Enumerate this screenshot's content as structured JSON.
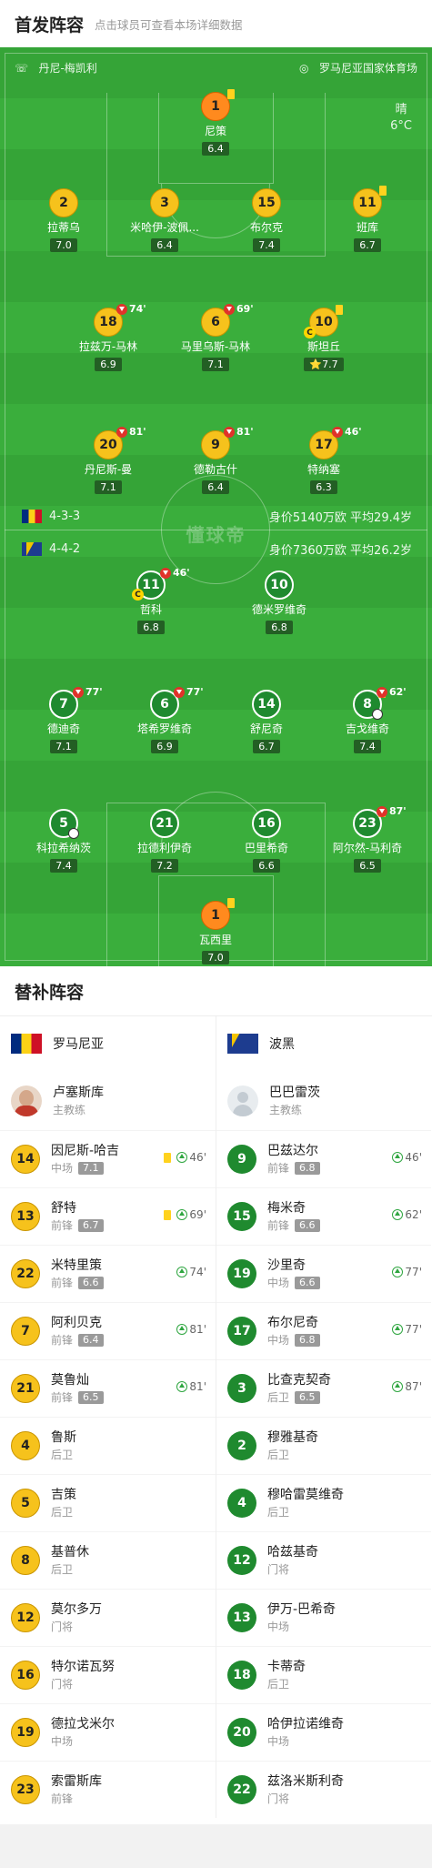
{
  "header": {
    "title": "首发阵容",
    "subtitle": "点击球员可查看本场详细数据"
  },
  "pitch_info": {
    "referee": "丹尼-梅凯利",
    "stadium": "罗马尼亚国家体育场",
    "weather": "晴",
    "temperature": "6°C",
    "watermark": "懂球帝"
  },
  "home": {
    "name": "罗马尼亚",
    "formation": "4-3-3",
    "value_label": "身价5140万欧 平均29.4岁",
    "players": [
      {
        "num": "1",
        "name": "尼策",
        "rating": "6.4",
        "style": "o",
        "yellow": true
      },
      {
        "num": "2",
        "name": "拉蒂乌",
        "rating": "7.0",
        "style": "y"
      },
      {
        "num": "3",
        "name": "米哈伊-波佩...",
        "rating": "6.4",
        "style": "y"
      },
      {
        "num": "15",
        "name": "布尔克",
        "rating": "7.4",
        "style": "y"
      },
      {
        "num": "11",
        "name": "班库",
        "rating": "6.7",
        "style": "y",
        "yellow": true
      },
      {
        "num": "18",
        "name": "拉兹万-马林",
        "rating": "6.9",
        "style": "y",
        "off": "74'"
      },
      {
        "num": "6",
        "name": "马里乌斯-马林",
        "rating": "7.1",
        "style": "y",
        "off": "69'"
      },
      {
        "num": "10",
        "name": "斯坦丘",
        "rating": "7.7",
        "style": "y",
        "yellow": true,
        "captain": "C",
        "star": "⭐"
      },
      {
        "num": "20",
        "name": "丹尼斯-曼",
        "rating": "7.1",
        "style": "y",
        "off": "81'"
      },
      {
        "num": "9",
        "name": "德勒古什",
        "rating": "6.4",
        "style": "y",
        "off": "81'"
      },
      {
        "num": "17",
        "name": "特纳塞",
        "rating": "6.3",
        "style": "y",
        "off": "46'"
      }
    ]
  },
  "away": {
    "name": "波黑",
    "formation": "4-4-2",
    "value_label": "身价7360万欧 平均26.2岁",
    "players": [
      {
        "num": "11",
        "name": "哲科",
        "rating": "6.8",
        "style": "g",
        "off": "46'",
        "captain": "C"
      },
      {
        "num": "10",
        "name": "德米罗维奇",
        "rating": "6.8",
        "style": "g"
      },
      {
        "num": "7",
        "name": "德迪奇",
        "rating": "7.1",
        "style": "g",
        "off": "77'"
      },
      {
        "num": "6",
        "name": "塔希罗维奇",
        "rating": "6.9",
        "style": "g",
        "off": "77'"
      },
      {
        "num": "14",
        "name": "舒尼奇",
        "rating": "6.7",
        "style": "g"
      },
      {
        "num": "8",
        "name": "吉戈维奇",
        "rating": "7.4",
        "style": "g",
        "off": "62'",
        "yellow": true,
        "goal": true
      },
      {
        "num": "5",
        "name": "科拉希纳茨",
        "rating": "7.4",
        "style": "g",
        "goal": true
      },
      {
        "num": "21",
        "name": "拉德利伊奇",
        "rating": "7.2",
        "style": "g"
      },
      {
        "num": "16",
        "name": "巴里希奇",
        "rating": "6.6",
        "style": "g"
      },
      {
        "num": "23",
        "name": "阿尔然-马利奇",
        "rating": "6.5",
        "style": "g",
        "off": "87'",
        "yellow": true
      },
      {
        "num": "1",
        "name": "瓦西里",
        "rating": "7.0",
        "style": "o",
        "yellow": true
      }
    ]
  },
  "bench": {
    "title": "替补阵容",
    "home": {
      "team": "罗马尼亚",
      "coach": {
        "name": "卢塞斯库",
        "role": "主教练"
      },
      "subs": [
        {
          "num": "14",
          "name": "因尼斯-哈吉",
          "pos": "中场",
          "rating": "7.1",
          "yellow": true,
          "in": "46'"
        },
        {
          "num": "13",
          "name": "舒特",
          "pos": "前锋",
          "rating": "6.7",
          "yellow": true,
          "in": "69'"
        },
        {
          "num": "22",
          "name": "米特里策",
          "pos": "前锋",
          "rating": "6.6",
          "in": "74'"
        },
        {
          "num": "7",
          "name": "阿利贝克",
          "pos": "前锋",
          "rating": "6.4",
          "in": "81'"
        },
        {
          "num": "21",
          "name": "莫鲁灿",
          "pos": "前锋",
          "rating": "6.5",
          "in": "81'"
        },
        {
          "num": "4",
          "name": "鲁斯",
          "pos": "后卫"
        },
        {
          "num": "5",
          "name": "吉策",
          "pos": "后卫"
        },
        {
          "num": "8",
          "name": "基普休",
          "pos": "后卫"
        },
        {
          "num": "12",
          "name": "莫尔多万",
          "pos": "门将"
        },
        {
          "num": "16",
          "name": "特尔诺瓦努",
          "pos": "门将"
        },
        {
          "num": "19",
          "name": "德拉戈米尔",
          "pos": "中场"
        },
        {
          "num": "23",
          "name": "索雷斯库",
          "pos": "前锋"
        }
      ]
    },
    "away": {
      "team": "波黑",
      "coach": {
        "name": "巴巴雷茨",
        "role": "主教练"
      },
      "subs": [
        {
          "num": "9",
          "name": "巴兹达尔",
          "pos": "前锋",
          "rating": "6.8",
          "in": "46'"
        },
        {
          "num": "15",
          "name": "梅米奇",
          "pos": "前锋",
          "rating": "6.6",
          "in": "62'"
        },
        {
          "num": "19",
          "name": "沙里奇",
          "pos": "中场",
          "rating": "6.6",
          "in": "77'"
        },
        {
          "num": "17",
          "name": "布尔尼奇",
          "pos": "中场",
          "rating": "6.8",
          "in": "77'"
        },
        {
          "num": "3",
          "name": "比查克契奇",
          "pos": "后卫",
          "rating": "6.5",
          "in": "87'"
        },
        {
          "num": "2",
          "name": "穆雅基奇",
          "pos": "后卫"
        },
        {
          "num": "4",
          "name": "穆哈雷莫维奇",
          "pos": "后卫"
        },
        {
          "num": "12",
          "name": "哈兹基奇",
          "pos": "门将"
        },
        {
          "num": "13",
          "name": "伊万-巴希奇",
          "pos": "中场"
        },
        {
          "num": "18",
          "name": "卡蒂奇",
          "pos": "后卫"
        },
        {
          "num": "20",
          "name": "哈伊拉诺维奇",
          "pos": "中场"
        },
        {
          "num": "22",
          "name": "兹洛米斯利奇",
          "pos": "门将"
        }
      ]
    }
  }
}
